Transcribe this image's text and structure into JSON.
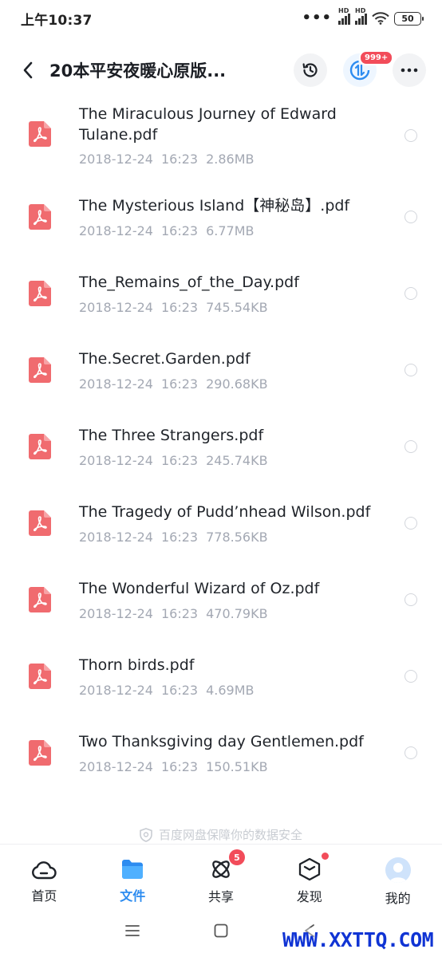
{
  "status_bar": {
    "time": "上午10:37",
    "signal_label": "HD",
    "battery": "50"
  },
  "header": {
    "title": "20本平安夜暖心原版...",
    "transfer_badge": "999+"
  },
  "files": [
    {
      "name": "The Miraculous Journey of Edward Tulane.pdf",
      "date": "2018-12-24",
      "time": "16:23",
      "size": "2.86MB"
    },
    {
      "name": "The Mysterious Island【神秘岛】.pdf",
      "date": "2018-12-24",
      "time": "16:23",
      "size": "6.77MB"
    },
    {
      "name": "The_Remains_of_the_Day.pdf",
      "date": "2018-12-24",
      "time": "16:23",
      "size": "745.54KB"
    },
    {
      "name": "The.Secret.Garden.pdf",
      "date": "2018-12-24",
      "time": "16:23",
      "size": "290.68KB"
    },
    {
      "name": "The Three Strangers.pdf",
      "date": "2018-12-24",
      "time": "16:23",
      "size": "245.74KB"
    },
    {
      "name": "The Tragedy of Pudd’nhead Wilson.pdf",
      "date": "2018-12-24",
      "time": "16:23",
      "size": "778.56KB"
    },
    {
      "name": "The Wonderful Wizard of Oz.pdf",
      "date": "2018-12-24",
      "time": "16:23",
      "size": "470.79KB"
    },
    {
      "name": "Thorn birds.pdf",
      "date": "2018-12-24",
      "time": "16:23",
      "size": "4.69MB"
    },
    {
      "name": "Two Thanksgiving day Gentlemen.pdf",
      "date": "2018-12-24",
      "time": "16:23",
      "size": "150.51KB"
    }
  ],
  "safe_notice": "百度网盘保障你的数据安全",
  "bottom_nav": {
    "items": [
      {
        "label": "首页",
        "icon": "cloud-home-icon"
      },
      {
        "label": "文件",
        "icon": "folder-icon",
        "active": true
      },
      {
        "label": "共享",
        "icon": "share-atom-icon",
        "badge": "5"
      },
      {
        "label": "发现",
        "icon": "cube-discover-icon",
        "dot": true
      },
      {
        "label": "我的",
        "icon": "avatar-icon"
      }
    ]
  },
  "watermark": "WWW.XXTTQ.COM",
  "colors": {
    "accent": "#2d8cf0",
    "pdf_red": "#f06b6f",
    "badge_red": "#f24c5a",
    "meta_gray": "#a3a8b3"
  }
}
